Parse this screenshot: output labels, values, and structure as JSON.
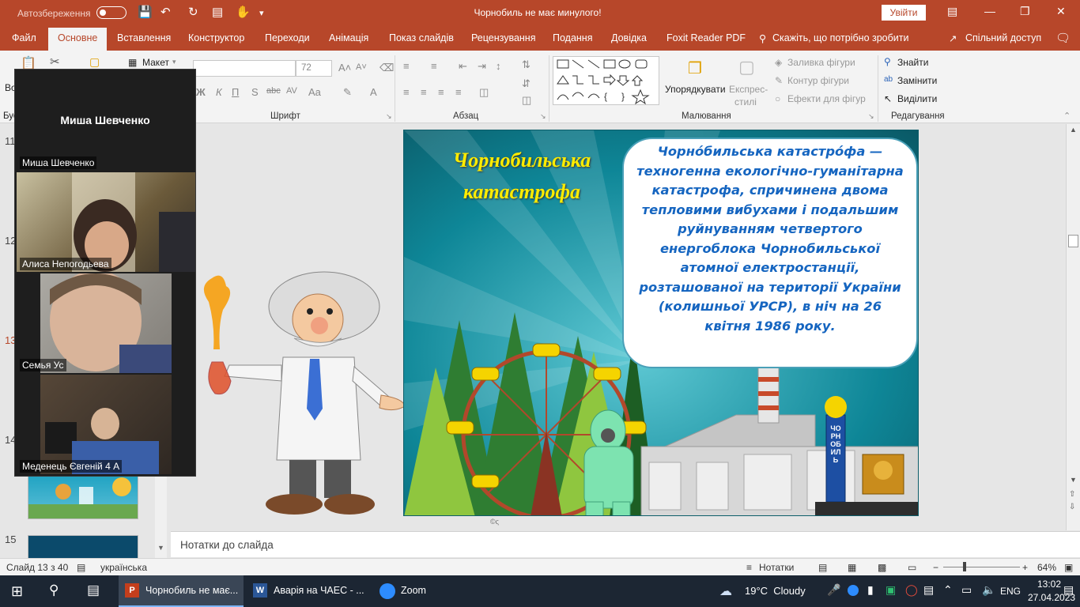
{
  "titlebar": {
    "autosave_label": "Автозбереження",
    "doc_title": "Чорнобиль не має минулого!",
    "signin_label": "Увійти"
  },
  "tabs": [
    "Файл",
    "Основне",
    "Вставлення",
    "Конструктор",
    "Переходи",
    "Анімація",
    "Показ слайдів",
    "Рецензування",
    "Подання",
    "Довідка",
    "Foxit Reader PDF"
  ],
  "tell_me": "Скажіть, що потрібно зробити",
  "share_label": "Спільний доступ",
  "ribbon": {
    "layout_label": "Макет",
    "font_size": "72",
    "group_font": "Шрифт",
    "group_paragraph": "Абзац",
    "group_drawing": "Малювання",
    "group_editing": "Редагування",
    "arrange_label": "Упорядкувати",
    "express_styles_1": "Експрес-",
    "express_styles_2": "стилі",
    "shape_fill": "Заливка фігури",
    "shape_outline": "Контур фігури",
    "shape_effects": "Ефекти для фігур",
    "find": "Знайти",
    "replace": "Замінити",
    "select": "Виділити",
    "slides_left_1": "Во",
    "slides_left_2": "Бус"
  },
  "slides": {
    "numbers": [
      "11",
      "12",
      "13",
      "14",
      "15"
    ]
  },
  "zoom": {
    "active_speaker": "Миша Шевченко",
    "participants": [
      "Миша Шевченко",
      "Алиса Непогодьева",
      "Семья Ус",
      "Меденець Євгеній 4 А"
    ]
  },
  "slide": {
    "title_line1": "Чорнобильська",
    "title_line2": "катастрофа",
    "body": "Чорно́бильська катастро́фа — техногенна екологічно-гуманітарна катастрофа, спричинена двома тепловими вибухами і подальшим руйнуванням четвертого енергоблока Чорнобильської атомної електростанції, розташованої на території України (колишньої УРСР), в ніч на 26 квітня 1986 року.",
    "sign_text": "ЧОРНОБИЛЬ",
    "footer_mark": "©ς"
  },
  "notes_placeholder": "Нотатки до слайда",
  "statusbar": {
    "slide_counter": "Слайд 13 з 40",
    "language": "українська",
    "notes_button": "Нотатки",
    "zoom_level": "64%"
  },
  "taskbar": {
    "items": [
      "Чорнобиль не має...",
      "Аварія на ЧАЕС - ...",
      "Zoom"
    ],
    "weather": "19°C  Cloudy",
    "lang": "ENG",
    "time": "13:02",
    "date": "27.04.2023"
  },
  "colors": {
    "ppt_accent": "#b7472a",
    "slide_title": "#ffec00",
    "slide_body": "#1565c0",
    "slide_bg": "#0a6f7d"
  }
}
